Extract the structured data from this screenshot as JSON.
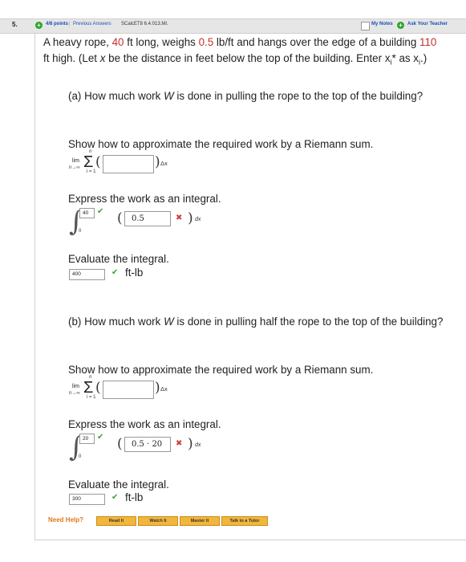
{
  "header": {
    "question_number": "5.",
    "points": "4/8 points",
    "separator": "|",
    "previous_answers": "Previous Answers",
    "course_code": "SCalcET8 6.4.013.MI.",
    "my_notes": "My Notes",
    "ask_teacher": "Ask Your Teacher"
  },
  "problem": {
    "text_a": "A heavy rope, ",
    "length": "40",
    "text_b": " ft long, weighs ",
    "weight": "0.5",
    "text_c": " lb/ft and hangs over the edge of a building ",
    "height": "110",
    "text_d": " ft high. (Let ",
    "var_x": "x",
    "text_e": " be the distance in feet below the top of the building. Enter x",
    "sub_i": "i",
    "text_f": "* as x",
    "sub_i2": "i",
    "text_g": ".)"
  },
  "part_a": {
    "question_pre": "(a) How much work ",
    "question_w": "W",
    "question_post": " is done in pulling the rope to the top of the building?",
    "riemann_prompt": "Show how to approximate the required work by a Riemann sum.",
    "lim": "lim",
    "lim_sub": "n→∞",
    "sigma_top": "n",
    "sigma_bottom": "i = 1",
    "riemann_input": "",
    "dx": "Δx",
    "integral_prompt": "Express the work as an integral.",
    "upper_limit": "40",
    "lower_limit": "0",
    "integrand": "0.5",
    "dx_integral": "dx",
    "evaluate_prompt": "Evaluate the integral.",
    "answer": "400",
    "unit": "ft-lb"
  },
  "part_b": {
    "question_pre": "(b) How much work ",
    "question_w": "W",
    "question_post": " is done in pulling half the rope to the top of the building?",
    "riemann_prompt": "Show how to approximate the required work by a Riemann sum.",
    "lim": "lim",
    "lim_sub": "n→∞",
    "sigma_top": "n",
    "sigma_bottom": "i = 1",
    "riemann_input": "",
    "dx": "Δx",
    "integral_prompt": "Express the work as an integral.",
    "upper_limit": "20",
    "lower_limit": "0",
    "integrand": "0.5 · 20",
    "dx_integral": "dx",
    "evaluate_prompt": "Evaluate the integral.",
    "answer": "300",
    "unit": "ft-lb"
  },
  "help": {
    "label": "Need Help?",
    "read": "Read It",
    "watch": "Watch It",
    "master": "Master It",
    "tutor": "Talk to a Tutor"
  },
  "symbols": {
    "check": "✔",
    "cross": "✖",
    "integral": "∫",
    "sigma": "Σ",
    "open_paren": "(",
    "close_paren": ")"
  },
  "colors": {
    "accent_red": "#c5302e",
    "check_green": "#3aa33a",
    "cross_red": "#d93a3a",
    "link_blue": "#1a4fb8",
    "help_orange": "#e07a1a",
    "button_gold": "#f2b63c"
  }
}
